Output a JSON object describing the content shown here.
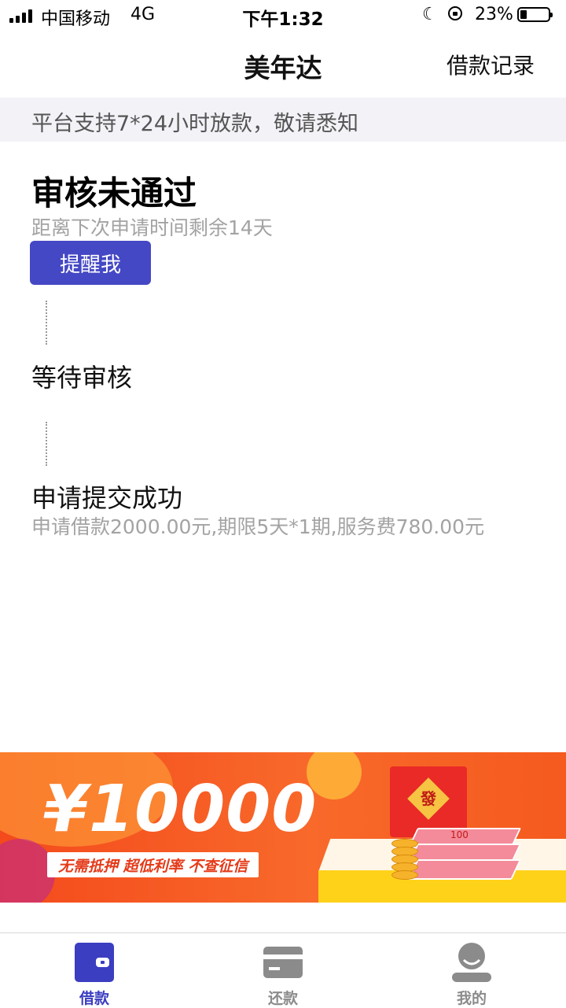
{
  "status_bar": {
    "carrier": "中国移动",
    "network": "4G",
    "time": "下午1:32",
    "battery_percent": "23%",
    "battery_level": 0.23
  },
  "nav": {
    "title": "美年达",
    "action_label": "借款记录"
  },
  "notice": {
    "text": "平台支持7*24小时放款，敬请悉知"
  },
  "timeline": {
    "rejected": {
      "title": "审核未通过",
      "subtitle": "距离下次申请时间剩余14天",
      "button_label": "提醒我"
    },
    "pending": {
      "title": "等待审核"
    },
    "submitted": {
      "title": "申请提交成功",
      "subtitle": "申请借款2000.00元,期限5天*1期,服务费780.00元"
    }
  },
  "banner": {
    "amount": "¥10000",
    "tags": "无需抵押  超低利率  不查征信",
    "envelope_char": "發",
    "cash_label": "100"
  },
  "tabs": [
    {
      "label": "借款",
      "icon": "wallet-icon",
      "active": true
    },
    {
      "label": "还款",
      "icon": "card-icon",
      "active": false
    },
    {
      "label": "我的",
      "icon": "profile-icon",
      "active": false
    }
  ],
  "colors": {
    "accent": "#4548c4",
    "tab_active": "#3b3ec0",
    "tab_inactive": "#8b8b8b",
    "subtext": "#a3a3a3",
    "notice_bg": "#f2f2f7",
    "banner_orange": "#f55a1e"
  }
}
